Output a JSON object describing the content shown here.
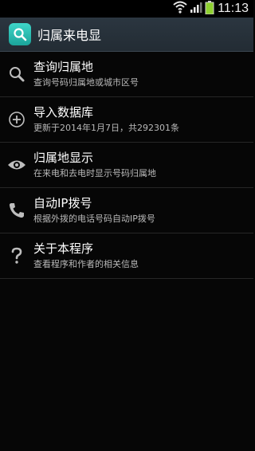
{
  "status_bar": {
    "time": "11:13",
    "icons": [
      "wifi-icon",
      "signal-icon",
      "battery-icon"
    ]
  },
  "action_bar": {
    "app_icon": "search-icon",
    "title": "归属来电显"
  },
  "menu": [
    {
      "icon": "search-icon",
      "title": "查询归属地",
      "subtitle": "查询号码归属地或城市区号"
    },
    {
      "icon": "plus-circle-icon",
      "title": "导入数据库",
      "subtitle": "更新于2014年1月7日，共292301条"
    },
    {
      "icon": "eye-icon",
      "title": "归属地显示",
      "subtitle": "在来电和去电时显示号码归属地"
    },
    {
      "icon": "phone-icon",
      "title": "自动IP拨号",
      "subtitle": "根据外拨的电话号码自动IP拨号"
    },
    {
      "icon": "question-icon",
      "title": "关于本程序",
      "subtitle": "查看程序和作者的相关信息"
    }
  ],
  "colors": {
    "background": "#060606",
    "action_bar": "#26303a",
    "app_icon": "#2ec0b4",
    "divider": "#262626",
    "battery": "#8fd12f"
  }
}
